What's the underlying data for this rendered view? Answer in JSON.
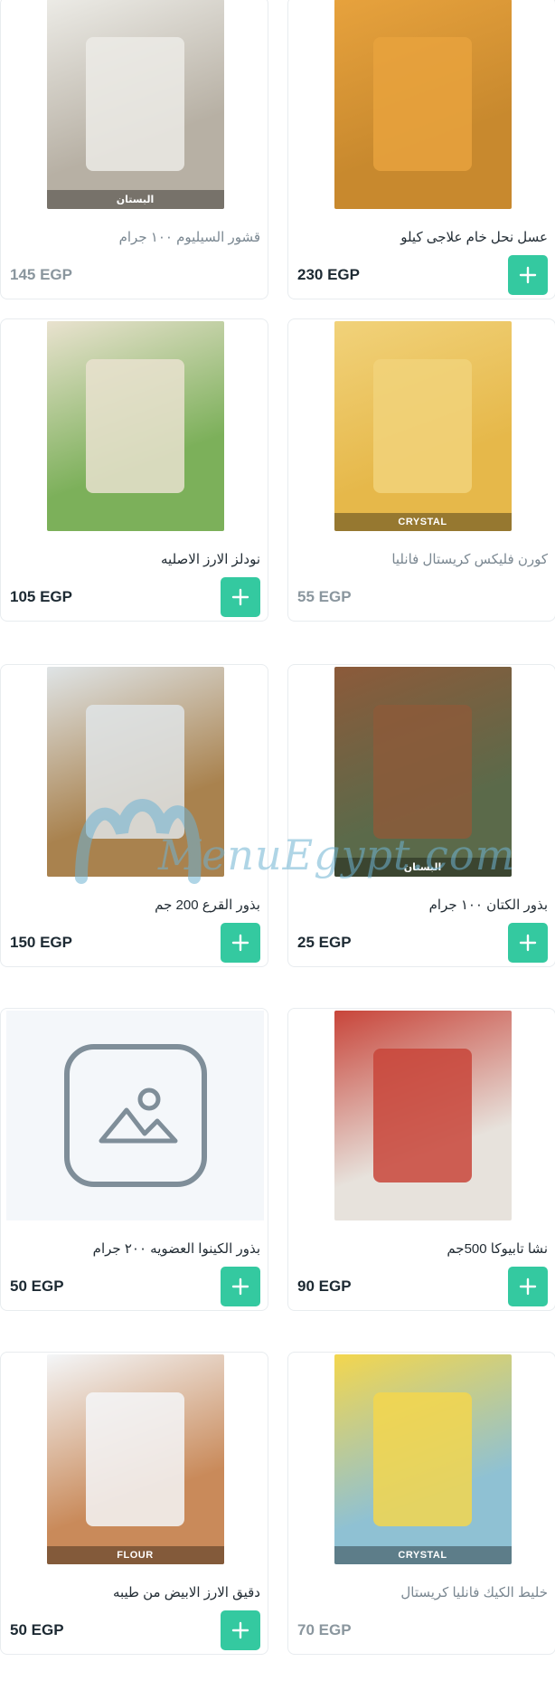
{
  "currency_note": "EGP",
  "products": [
    {
      "title": "عسل نحل خام علاجى كيلو",
      "price": "230 EGP",
      "available": true,
      "image": "honey-jar-photo",
      "photo_bg": "#c8892e",
      "photo_accent": "#e7a23d",
      "photo_label": ""
    },
    {
      "title": "قشور السيليوم ١٠٠ جرام",
      "price": "145 EGP",
      "available": false,
      "image": "psyllium-bag-photo",
      "photo_bg": "#b7b0a4",
      "photo_accent": "#ecebe6",
      "photo_label": "البستان"
    },
    {
      "title": "كورن فليكس كريستال فانليا",
      "price": "55 EGP",
      "available": false,
      "image": "corn-flakes-box-photo",
      "photo_bg": "#e6b84a",
      "photo_accent": "#f1d27a",
      "photo_label": "Crystal"
    },
    {
      "title": "نودلز الارز الاصليه",
      "price": "105 EGP",
      "available": true,
      "image": "rice-noodles-pack-photo",
      "photo_bg": "#7cb05a",
      "photo_accent": "#e9e2cf",
      "photo_label": ""
    },
    {
      "title": "بذور الكتان ١٠٠ جرام",
      "price": "25 EGP",
      "available": true,
      "image": "flax-seeds-bag-photo",
      "photo_bg": "#5b6a4a",
      "photo_accent": "#8c5a3a",
      "photo_label": "البستان"
    },
    {
      "title": "بذور القرع 200 جم",
      "price": "150 EGP",
      "available": true,
      "image": "pumpkin-seeds-bag-photo",
      "photo_bg": "#a9824e",
      "photo_accent": "#dfe4e6",
      "photo_label": ""
    },
    {
      "title": "نشا تابيوكا 500جم",
      "price": "90 EGP",
      "available": true,
      "image": "tapioca-sack-photo",
      "photo_bg": "#e7e2dc",
      "photo_accent": "#c8453a",
      "photo_label": ""
    },
    {
      "title": "بذور الكينوا العضويه ٢٠٠ جرام",
      "price": "50 EGP",
      "available": true,
      "image": "no-image-placeholder",
      "photo_bg": "",
      "photo_accent": "",
      "photo_label": ""
    },
    {
      "title": "خليط الكيك فانليا كريستال",
      "price": "70 EGP",
      "available": false,
      "image": "cake-mix-box-photo",
      "photo_bg": "#8fc1d3",
      "photo_accent": "#f3d64e",
      "photo_label": "Crystal"
    },
    {
      "title": "دقيق الارز الابيض من طيبه",
      "price": "50 EGP",
      "available": true,
      "image": "rice-flour-bag-photo",
      "photo_bg": "#c98a5a",
      "photo_accent": "#f4f6f8",
      "photo_label": "Flour"
    }
  ],
  "watermark": {
    "text": "MenuEgypt.com"
  },
  "colors": {
    "accent": "#34c9a0",
    "text": "#222c34",
    "muted": "#7a8791",
    "border": "#e8ecef"
  }
}
